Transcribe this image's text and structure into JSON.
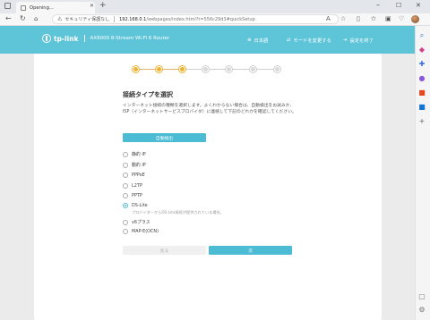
{
  "browser": {
    "tab_title": "Opening...",
    "security_label": "セキュリティ保護なし",
    "url_host": "192.168.0.1",
    "url_path": "/webpages/index.html?t=556c29d3#quickSetup"
  },
  "header": {
    "brand": "tp-link",
    "model": "AX6000 8-Stream Wi-Fi 6 Router",
    "language": "日本語",
    "mode": "モードを変更する",
    "exit": "設定を終了"
  },
  "steps": {
    "done": 3,
    "total": 7
  },
  "main": {
    "title": "接続タイプを選択",
    "description": "インターネット接続の種類を選択します。よくわからない場合は、自動検出をお試みか、ISP（インターネットサービスプロバイダ）に連絡して下記のどれかを確認してください。",
    "auto_detect": "自動検出",
    "options": [
      {
        "label": "静的 IP",
        "checked": false
      },
      {
        "label": "動的 IP",
        "checked": false
      },
      {
        "label": "PPPoE",
        "checked": false
      },
      {
        "label": "L2TP",
        "checked": false
      },
      {
        "label": "PPTP",
        "checked": false
      },
      {
        "label": "DS-Lite",
        "checked": true
      },
      {
        "label": "v6プラス",
        "checked": false
      },
      {
        "label": "MAP-E(OCN)",
        "checked": false
      }
    ],
    "dslite_note": "プロバイダーからDS-Lite接続が提供されている場合。",
    "back": "戻る",
    "next": "次"
  },
  "colors": {
    "accent": "#4cbcd4",
    "header": "#5ec4d8",
    "step_done": "#f0b331"
  }
}
